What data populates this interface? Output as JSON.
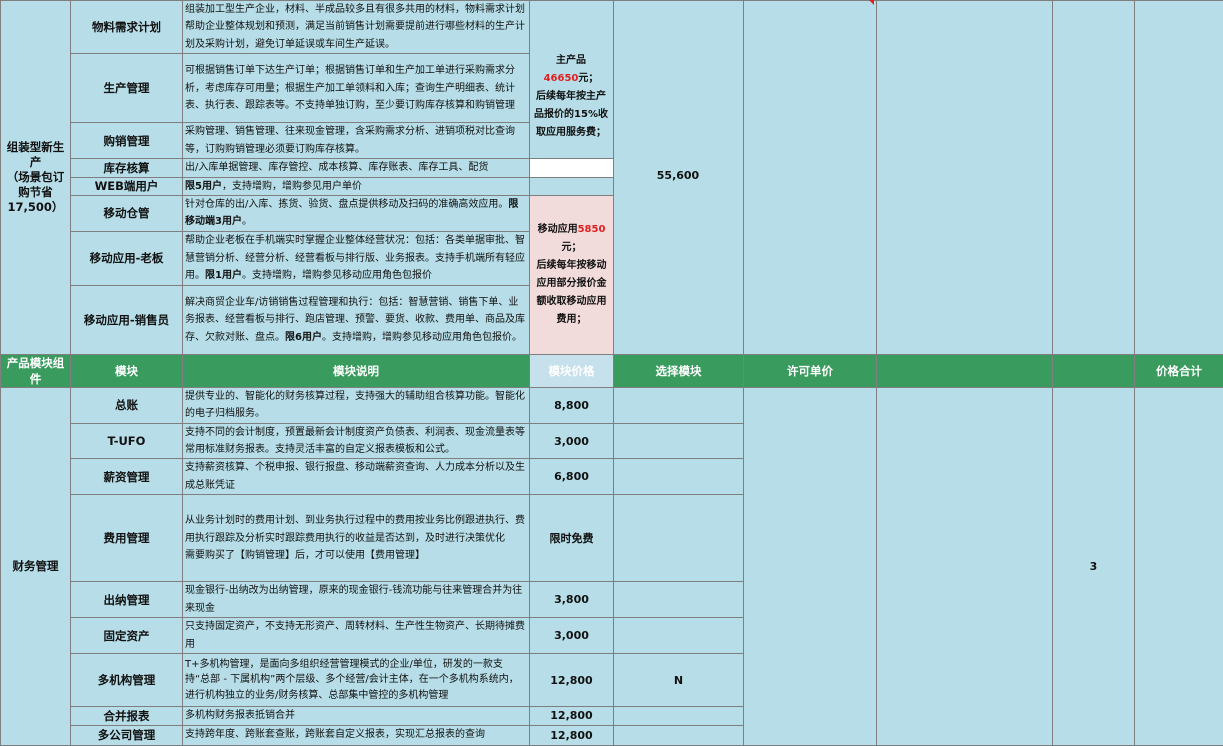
{
  "top_section": {
    "group_label": "组装型新生产\n（场景包订购节省17,500）",
    "rows": [
      {
        "module": "物料需求计划",
        "desc": "组装加工型生产企业，材料、半成品较多且有很多共用的材料，物料需求计划帮助企业整体规划和预测，满足当前销售计划需要提前进行哪些材料的生产计划及采购计划，避免订单延误或车间生产延误。"
      },
      {
        "module": "生产管理",
        "desc": "可根据销售订单下达生产订单；根据销售订单和生产加工单进行采购需求分析，考虑库存可用量；根据生产加工单领料和入库；查询生产明细表、统计表、执行表、跟踪表等。不支持单独订购，至少要订购库存核算和购销管理"
      },
      {
        "module": "购销管理",
        "desc": "采购管理、销售管理、往来现金管理，含采购需求分析、进销项税对比查询等，订购购销管理必须要订购库存核算。"
      },
      {
        "module": "库存核算",
        "desc": "出/入库单据管理、库存管控、成本核算、库存账表、库存工具、配货"
      },
      {
        "module": "WEB端用户",
        "desc_bold": "限5用户",
        "desc_rest": "，支持增购，增购参见用户单价"
      },
      {
        "module": "移动仓管",
        "desc_pre": "针对仓库的出/入库、拣货、验货、盘点提供移动及扫码的准确高效应用。",
        "desc_bold": "限移动端3用户",
        "desc_post": "。"
      },
      {
        "module": "移动应用-老板",
        "desc_pre": "帮助企业老板在手机端实时掌握企业整体经营状况：包括：各类单据审批、智慧营销分析、经营分析、经营看板与排行版、业务报表。支持手机端所有轻应用。",
        "desc_bold": "限1用户",
        "desc_post": "。支持增购，增购参见移动应用角色包报价"
      },
      {
        "module": "移动应用-销售员",
        "desc_pre": "解决商贸企业车/访销销售过程管理和执行：包括：智慧营销、销售下单、业务报表、经营看板与排行、跑店管理、预警、要货、收款、费用单、商品及库存、欠款对账、盘点。",
        "desc_bold": "限6用户",
        "desc_post": "。支持增购，增购参见移动应用角色包报价。"
      }
    ],
    "note_main": {
      "prefix": "主产品",
      "amount": "46650",
      "suffix": "元；\n后续每年按主产品报价的15%收取应用服务费；"
    },
    "note_mobile": {
      "prefix": "移动应用",
      "amount": "5850",
      "suffix": "元；\n后续每年按移动应用部分报价金额收取移动应用费用；"
    },
    "total_price": "55,600"
  },
  "header": {
    "group": "产品模块组件",
    "module": "模块",
    "desc": "模块说明",
    "price": "模块价格",
    "select": "选择模块",
    "license": "许可单价",
    "total": "价格合计"
  },
  "finance_section": {
    "group_label": "财务管理",
    "count": "3",
    "rows": [
      {
        "module": "总账",
        "desc": "提供专业的、智能化的财务核算过程，支持强大的辅助组合核算功能。智能化的电子归档服务。",
        "price": "8,800",
        "select": ""
      },
      {
        "module": "T-UFO",
        "desc": "支持不同的会计制度，预置最新会计制度资产负债表、利润表、现金流量表等常用标准财务报表。支持灵活丰富的自定义报表模板和公式。",
        "price": "3,000",
        "select": ""
      },
      {
        "module": "薪资管理",
        "desc": "支持薪资核算、个税申报、银行报盘、移动端薪资查询、人力成本分析以及生成总账凭证",
        "price": "6,800",
        "select": ""
      },
      {
        "module": "费用管理",
        "desc": "从业务计划时的费用计划、到业务执行过程中的费用按业务比例跟进执行、费用执行跟踪及分析实时跟踪费用执行的收益是否达到，及时进行决策优化\n需要购买了【购销管理】后，才可以使用【费用管理】",
        "price": "限时免费",
        "select": ""
      },
      {
        "module": "出纳管理",
        "desc": "现金银行-出纳改为出纳管理，原来的现金银行-钱流功能与往来管理合并为往来现金",
        "price": "3,800",
        "select": ""
      },
      {
        "module": "固定资产",
        "desc": "只支持固定资产，不支持无形资产、周转材料、生产性生物资产、长期待摊费用",
        "price": "3,000",
        "select": ""
      },
      {
        "module": "多机构管理",
        "desc": "T+多机构管理，是面向多组织经营管理模式的企业/单位，研发的一款支持“总部 - 下属机构”两个层级、多个经营/会计主体，在一个多机构系统内，进行机构独立的业务/财务核算、总部集中管控的多机构管理",
        "price": "12,800",
        "select": "N"
      },
      {
        "module": "合并报表",
        "desc": "多机构财务报表抵销合并",
        "price": "12,800",
        "select": ""
      },
      {
        "module": "多公司管理",
        "desc": "支持跨年度、跨账套查账，跨账套自定义报表，实现汇总报表的查询",
        "price": "12,800",
        "select": ""
      }
    ]
  }
}
